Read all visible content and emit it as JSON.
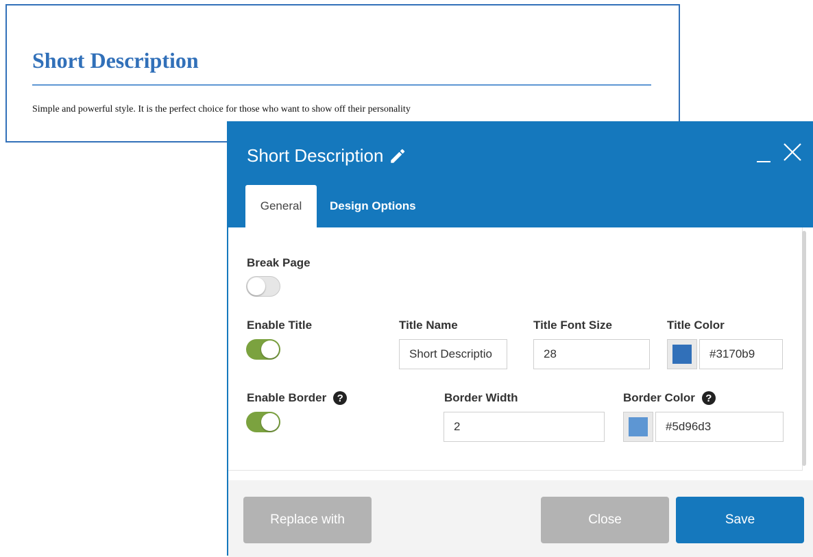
{
  "preview": {
    "title": "Short Description",
    "text": "Simple and powerful style. It is the perfect choice for those who want to show off their personality"
  },
  "dialog": {
    "title": "Short Description",
    "tabs": [
      {
        "label": "General",
        "active": true
      },
      {
        "label": "Design Options",
        "active": false
      }
    ],
    "fields": {
      "break_page": {
        "label": "Break Page",
        "enabled": false
      },
      "enable_title": {
        "label": "Enable Title",
        "enabled": true
      },
      "title_name": {
        "label": "Title Name",
        "value": "Short Descriptio"
      },
      "title_font_size": {
        "label": "Title Font Size",
        "value": "28"
      },
      "title_color": {
        "label": "Title Color",
        "value": "#3170b9"
      },
      "enable_border": {
        "label": "Enable Border",
        "enabled": true
      },
      "border_width": {
        "label": "Border Width",
        "value": "2"
      },
      "border_color": {
        "label": "Border Color",
        "value": "#5d96d3"
      }
    },
    "buttons": {
      "replace": "Replace with",
      "close": "Close",
      "save": "Save"
    }
  },
  "colors": {
    "accent": "#1578bd",
    "toggle_on": "#7ba23f",
    "title_color": "#3170b9",
    "border_color": "#5d96d3"
  },
  "icons": [
    "pencil-icon",
    "minimize-icon",
    "close-icon",
    "help-icon"
  ]
}
